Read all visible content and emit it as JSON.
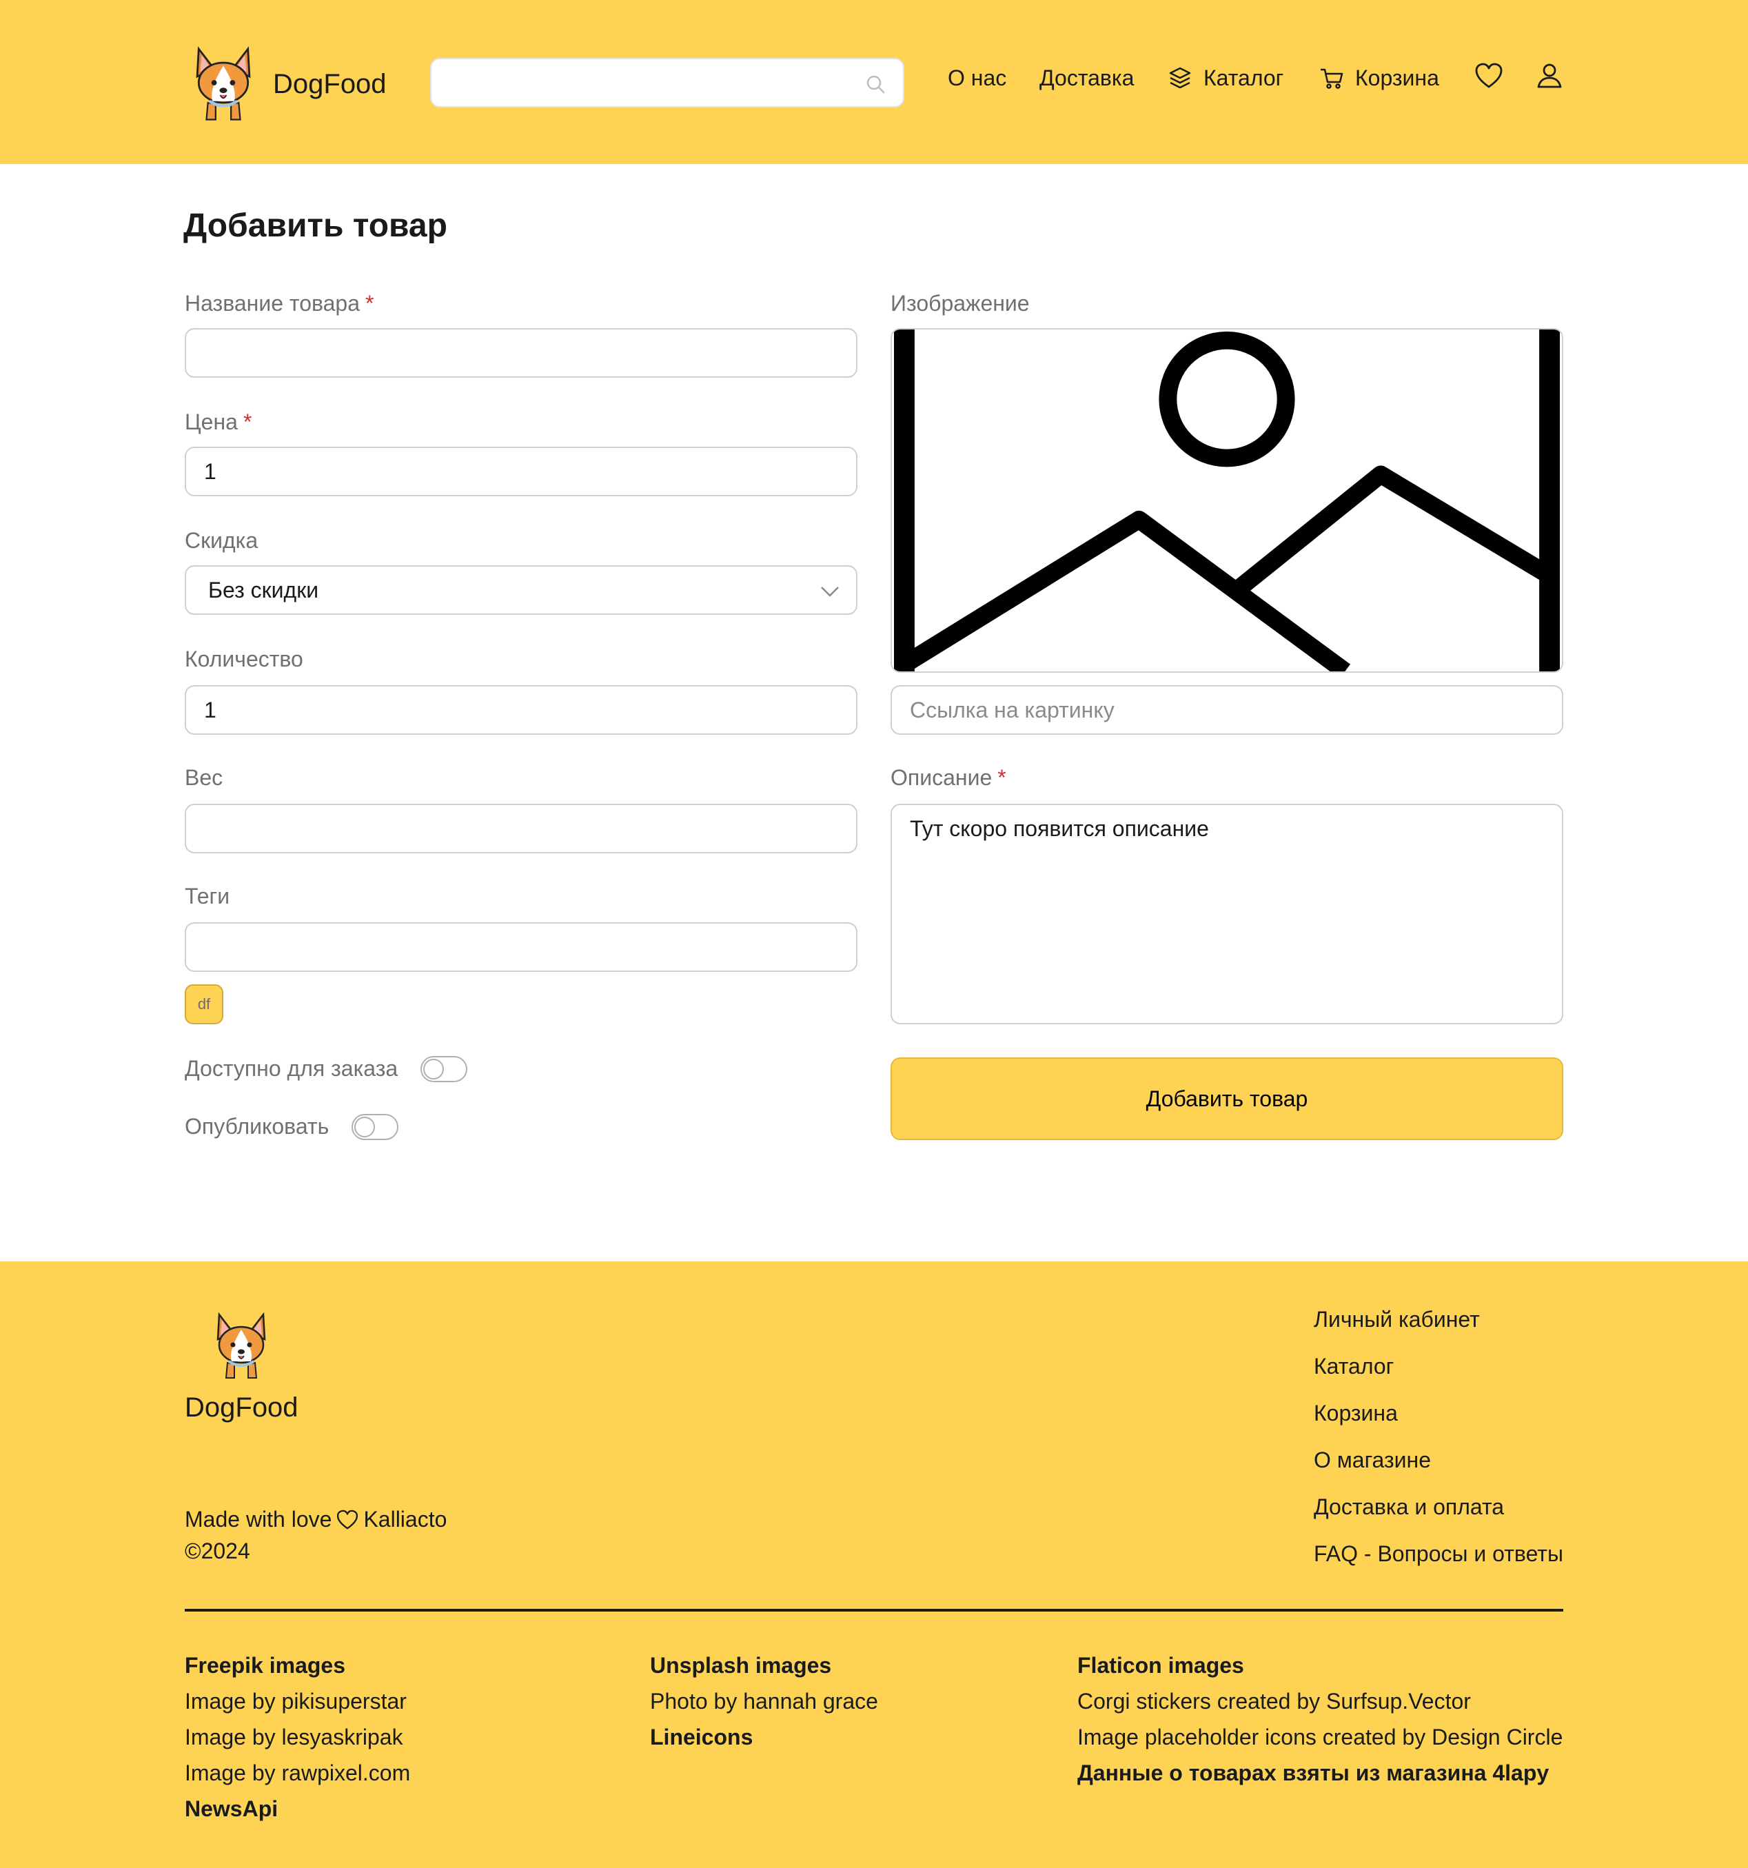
{
  "header": {
    "brand": "DogFood",
    "search": {
      "placeholder": "",
      "value": ""
    },
    "nav": {
      "about": "О нас",
      "delivery": "Доставка",
      "catalog": "Каталог",
      "cart": "Корзина"
    },
    "icons": [
      "corgi-logo-icon",
      "search-icon",
      "layers-icon",
      "cart-icon",
      "heart-icon",
      "user-icon"
    ]
  },
  "form": {
    "title": "Добавить товар",
    "fields": {
      "name": {
        "label": "Название товара",
        "value": ""
      },
      "price": {
        "label": "Цена",
        "value": "1"
      },
      "discount": {
        "label": "Скидка",
        "value": "Без скидки"
      },
      "quantity": {
        "label": "Количество",
        "value": "1"
      },
      "weight": {
        "label": "Вес",
        "value": ""
      },
      "tags": {
        "label": "Теги",
        "value": "",
        "chips": [
          "df"
        ]
      },
      "image": {
        "label": "Изображение",
        "link_placeholder": "Ссылка на картинку"
      },
      "description": {
        "label": "Описание",
        "value": "Тут скоро появится описание"
      }
    },
    "required_mark": "*",
    "toggles": {
      "available": {
        "label": "Доступно для заказа",
        "on": false
      },
      "publish": {
        "label": "Опубликовать",
        "on": false
      }
    },
    "submit_label": "Добавить товар"
  },
  "footer": {
    "brand": "DogFood",
    "made_with": "Made with love",
    "author": "Kalliacto",
    "copyright": "©2024",
    "links": [
      "Личный кабинет",
      "Каталог",
      "Корзина",
      "О магазине",
      "Доставка и оплата",
      "FAQ - Вопросы и ответы"
    ],
    "credits": {
      "col1": {
        "title": "Freepik images",
        "items": [
          "Image by pikisuperstar",
          "Image by lesyaskripak",
          "Image by rawpixel.com"
        ],
        "extra": "NewsApi"
      },
      "col2": {
        "title": "Unsplash images",
        "items": [
          "Photo by hannah grace"
        ],
        "extra": "Lineicons"
      },
      "col3": {
        "title": "Flaticon images",
        "items": [
          "Corgi stickers created by Surfsup.Vector",
          "Image placeholder icons created by Design Circle"
        ],
        "extra": "Данные о товарах взяты из магазина 4lapy"
      }
    }
  },
  "colors": {
    "accent": "#FED354",
    "required": "#d32f2f",
    "label": "#707070"
  }
}
